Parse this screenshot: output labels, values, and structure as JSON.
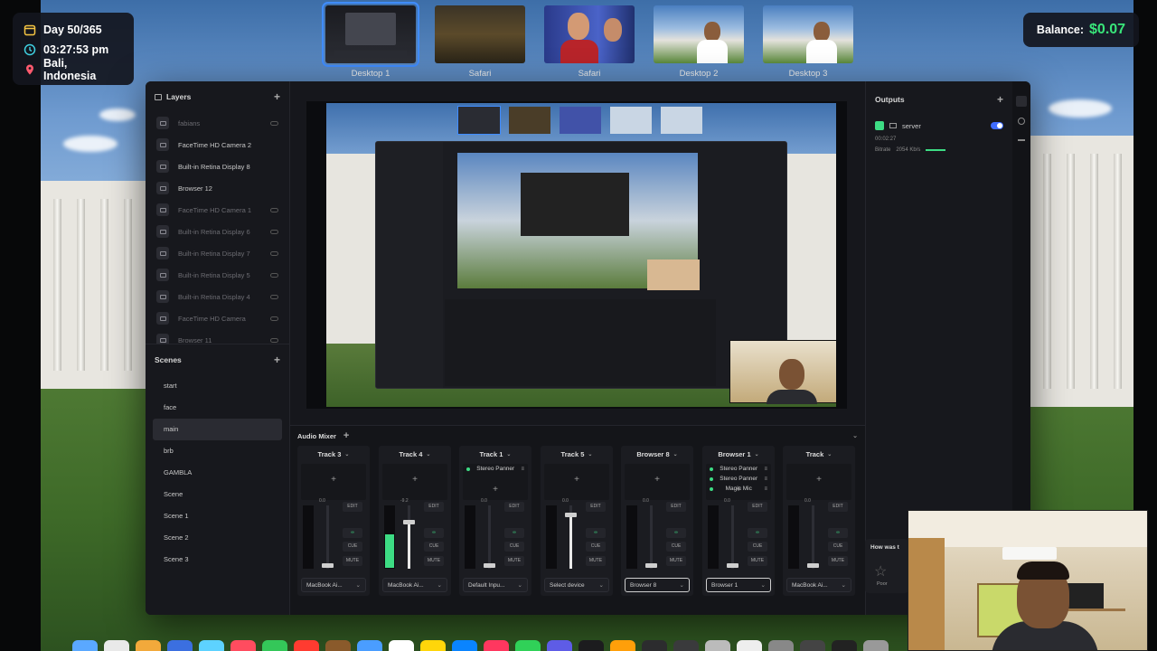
{
  "status": {
    "day": "Day 50/365",
    "time": "03:27:53 pm",
    "location": "Bali, Indonesia"
  },
  "balance": {
    "label": "Balance:",
    "value": "$0.07"
  },
  "spaces": [
    {
      "label": "Desktop 1",
      "active": true
    },
    {
      "label": "Safari",
      "active": false
    },
    {
      "label": "Safari",
      "active": false
    },
    {
      "label": "Desktop 2",
      "active": false
    },
    {
      "label": "Desktop 3",
      "active": false
    }
  ],
  "layers": {
    "title": "Layers",
    "items": [
      {
        "label": "fabians",
        "dim": true
      },
      {
        "label": "FaceTime HD Camera 2",
        "dim": false
      },
      {
        "label": "Built-in Retina Display 8",
        "dim": false
      },
      {
        "label": "Browser 12",
        "dim": false
      },
      {
        "label": "FaceTime HD Camera 1",
        "dim": true
      },
      {
        "label": "Built-in Retina Display 6",
        "dim": true
      },
      {
        "label": "Built-in Retina Display 7",
        "dim": true
      },
      {
        "label": "Built-in Retina Display 5",
        "dim": true
      },
      {
        "label": "Built-in Retina Display 4",
        "dim": true
      },
      {
        "label": "FaceTime HD Camera",
        "dim": true
      },
      {
        "label": "Browser 11",
        "dim": true
      }
    ]
  },
  "scenes": {
    "title": "Scenes",
    "items": [
      "start",
      "face",
      "main",
      "brb",
      "GAMBLA",
      "Scene",
      "Scene 1",
      "Scene 2",
      "Scene 3"
    ],
    "active": "main"
  },
  "outputs": {
    "title": "Outputs",
    "server": "server",
    "duration": "00:02:27",
    "bitrate_label": "Bitrate",
    "bitrate": "2054 Kb/s"
  },
  "mixer": {
    "title": "Audio Mixer",
    "edit": "EDIT",
    "cue": "CUE",
    "mute": "MUTE",
    "tracks": [
      {
        "name": "Track 3",
        "fx": [],
        "device": "MacBook Ai...",
        "meter": 0,
        "fader": 0.05,
        "db": "0.0"
      },
      {
        "name": "Track 4",
        "fx": [],
        "device": "MacBook Ai...",
        "meter": 0.55,
        "fader": 0.78,
        "db": "-9.2"
      },
      {
        "name": "Track 1",
        "fx": [
          "Stereo Panner"
        ],
        "device": "Default Inpu...",
        "meter": 0,
        "fader": 0.05,
        "db": "0.0"
      },
      {
        "name": "Track 5",
        "fx": [],
        "device": "Select device",
        "meter": 0,
        "fader": 0.9,
        "db": "0.0"
      },
      {
        "name": "Browser 8",
        "fx": [],
        "device": "Browser 8",
        "meter": 0,
        "fader": 0.05,
        "db": "0.0"
      },
      {
        "name": "Browser 1",
        "fx": [
          "Stereo Panner",
          "Stereo Panner",
          "Magic Mic"
        ],
        "device": "Browser 1",
        "meter": 0,
        "fader": 0.05,
        "db": "0.0"
      },
      {
        "name": "Track",
        "fx": [],
        "device": "MacBook Ai...",
        "meter": 0,
        "fader": 0.05,
        "db": "0.0"
      }
    ]
  },
  "feedback": {
    "question": "How was t",
    "poor": "Poor"
  },
  "colors": {
    "accent": "#3f8cff",
    "balance_green": "#39e67a",
    "meter_green": "#3ddc84"
  }
}
